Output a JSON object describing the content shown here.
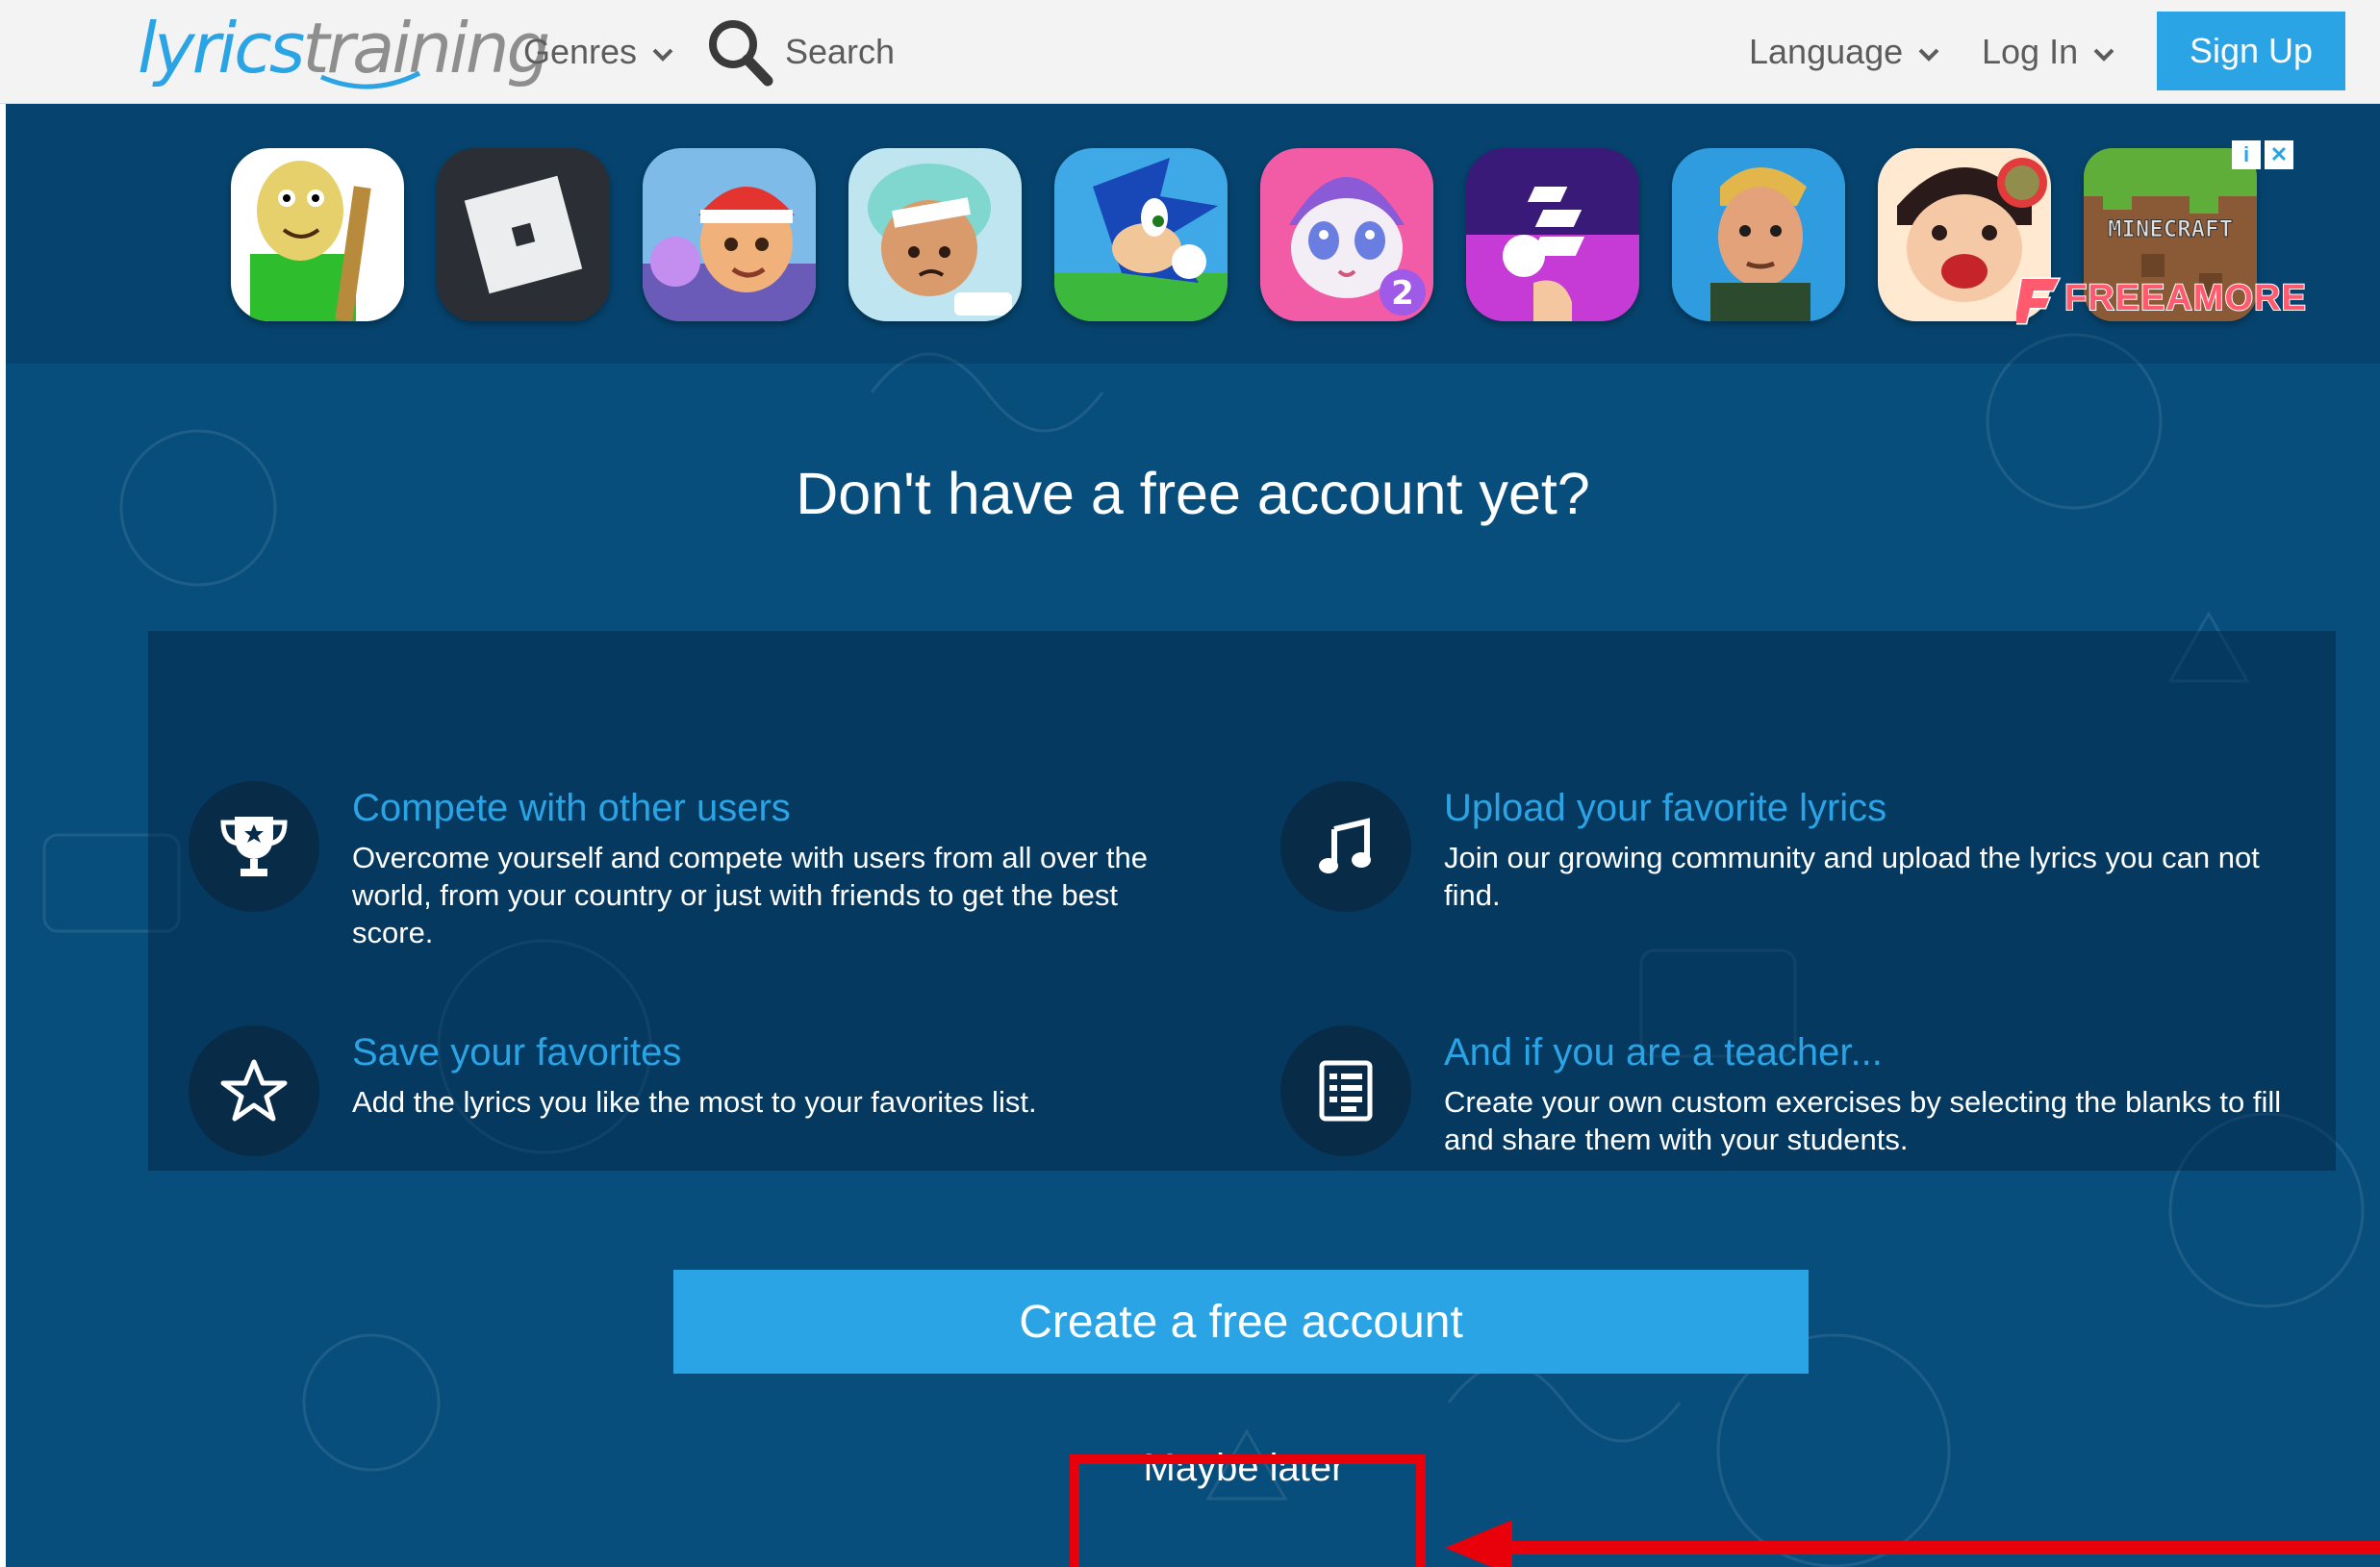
{
  "header": {
    "logo_part1": "lyrics",
    "logo_part2": "training",
    "genres_label": "Genres",
    "search_label": "Search",
    "language_label": "Language",
    "login_label": "Log In",
    "signup_label": "Sign Up"
  },
  "ad": {
    "apps": [
      {
        "icon": "baldi-game-icon"
      },
      {
        "icon": "roblox-icon"
      },
      {
        "icon": "subway-surfers-icon"
      },
      {
        "icon": "toca-hospital-icon"
      },
      {
        "icon": "sonic-icon"
      },
      {
        "icon": "my-talking-angela-2-icon"
      },
      {
        "icon": "tiles-hop-icon"
      },
      {
        "icon": "fortnite-icon"
      },
      {
        "icon": "dentist-kid-game-icon"
      },
      {
        "icon": "minecraft-icon"
      }
    ],
    "minecraft_text": "MINECRAFT",
    "badge_text": "2",
    "brand_text": "FREEAMORE",
    "info_label": "i",
    "close_label": "✕"
  },
  "main": {
    "title": "Don't have a free account yet?",
    "features": [
      {
        "icon": "trophy-icon",
        "title": "Compete with other users",
        "text": "Overcome yourself and compete with users from all over the world, from your country or just with friends to get the best score."
      },
      {
        "icon": "music-note-icon",
        "title": "Upload your favorite lyrics",
        "text": "Join our growing community and upload the lyrics you can not find."
      },
      {
        "icon": "star-icon",
        "title": "Save your favorites",
        "text": "Add the lyrics you like the most to your favorites list."
      },
      {
        "icon": "document-icon",
        "title": "And if you are a teacher...",
        "text": "Create your own custom exercises by selecting the blanks to fill and share them with your students."
      }
    ],
    "create_button": "Create a free account",
    "maybe_later": "Maybe later"
  },
  "colors": {
    "accent": "#2aa4e4",
    "background": "#074e7d",
    "annotation": "#e8000b"
  }
}
